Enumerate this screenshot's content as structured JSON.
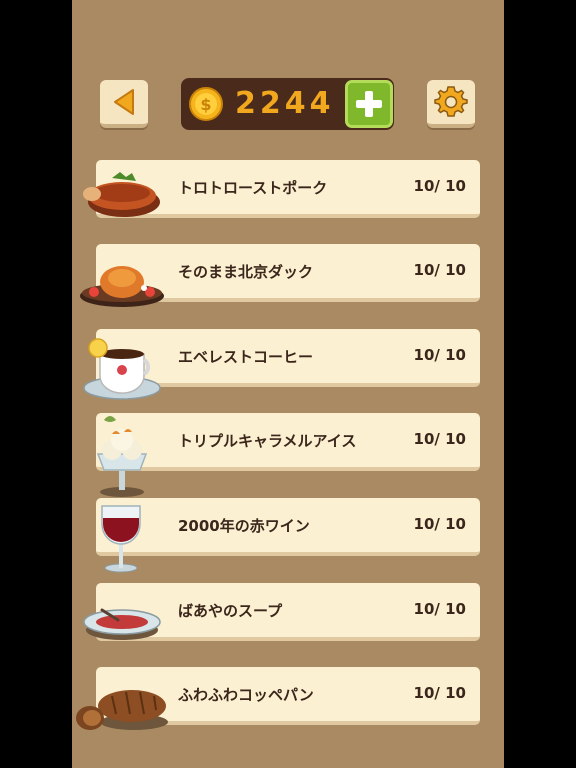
{
  "header": {
    "coins": "2244",
    "back_icon": "back-arrow-icon",
    "settings_icon": "gear-icon",
    "add_icon": "plus-icon",
    "coin_icon": "coin-icon"
  },
  "colors": {
    "panel": "#a98a63",
    "row_bg": "#fcf0d2",
    "coin_text": "#f2a81e",
    "plus_green": "#7fb92b"
  },
  "dishes": [
    {
      "name": "トロトローストポーク",
      "progress": "10/ 10",
      "icon": "roast-pork-icon"
    },
    {
      "name": "そのまま北京ダック",
      "progress": "10/ 10",
      "icon": "peking-duck-icon"
    },
    {
      "name": "エベレストコーヒー",
      "progress": "10/ 10",
      "icon": "coffee-cup-icon"
    },
    {
      "name": "トリプルキャラメルアイス",
      "progress": "10/ 10",
      "icon": "ice-cream-icon"
    },
    {
      "name": "2000年の赤ワイン",
      "progress": "10/ 10",
      "icon": "red-wine-icon"
    },
    {
      "name": "ばあやのスープ",
      "progress": "10/ 10",
      "icon": "soup-bowl-icon"
    },
    {
      "name": "ふわふわコッペパン",
      "progress": "10/ 10",
      "icon": "bread-icon"
    }
  ]
}
